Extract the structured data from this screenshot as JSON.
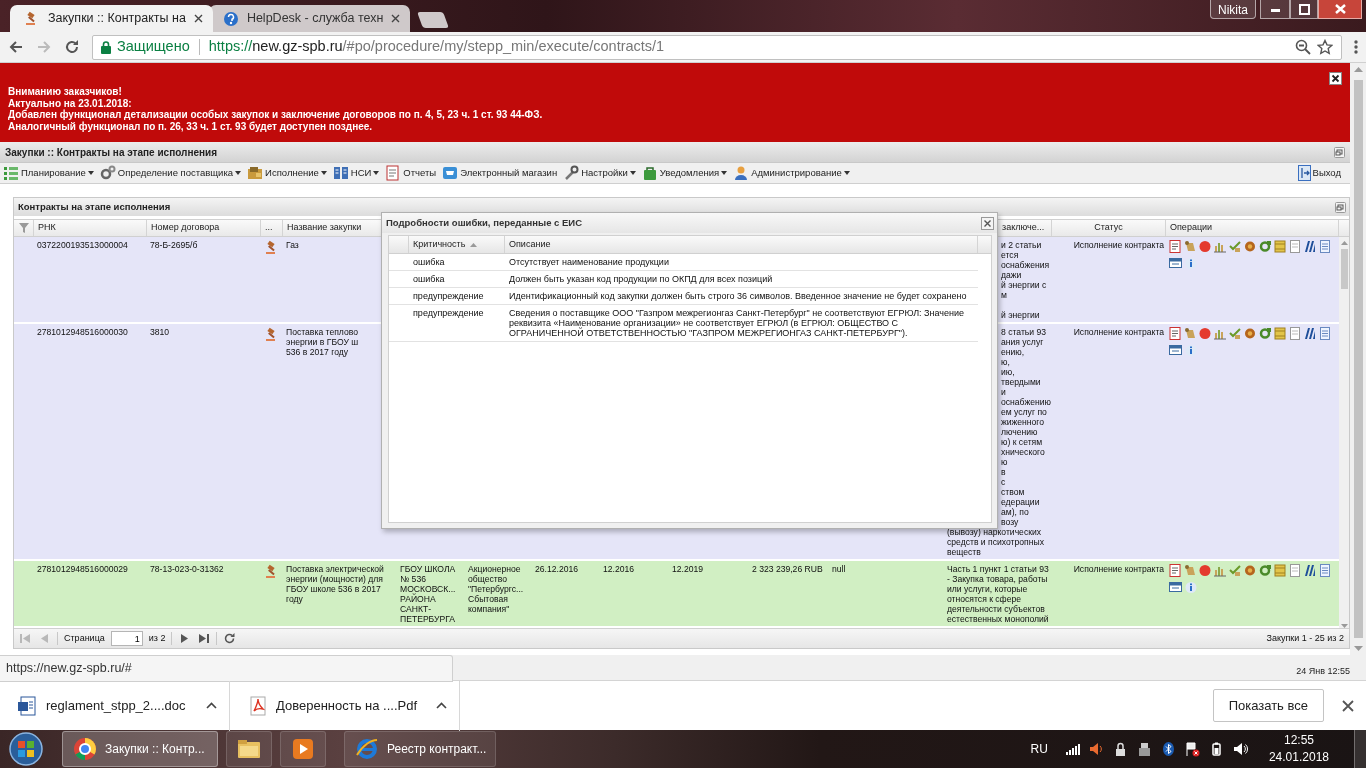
{
  "browser": {
    "tabs": [
      {
        "title": "Закупки :: Контракты на",
        "selected": true,
        "kind": "gavel"
      },
      {
        "title": "HelpDesk - служба техн",
        "selected": false,
        "kind": "help"
      }
    ],
    "profile": "Nikita",
    "security_label": "Защищено",
    "url": {
      "scheme": "https://",
      "host": "new.gz-spb.ru",
      "path": "/#po/procedure/my/stepp_min/execute/contracts/1"
    }
  },
  "banner": {
    "lines": [
      "Вниманию заказчиков!",
      "Актуально на 23.01.2018:",
      "Добавлен функционал детализации особых закупок и заключение договоров по п. 4, 5, 23 ч. 1 ст. 93 44-ФЗ.",
      "Аналогичный функционал по п. 26, 33 ч. 1 ст. 93 будет доступен позднее."
    ]
  },
  "app": {
    "title": "Закупки :: Контракты на этапе исполнения",
    "menu": [
      {
        "label": "Планирование",
        "dropdown": true,
        "kind": "plan"
      },
      {
        "label": "Определение поставщика",
        "dropdown": true,
        "kind": "gears"
      },
      {
        "label": "Исполнение",
        "dropdown": true,
        "kind": "box"
      },
      {
        "label": "НСИ",
        "dropdown": true,
        "kind": "book"
      },
      {
        "label": "Отчеты",
        "dropdown": false,
        "kind": "report"
      },
      {
        "label": "Электронный магазин",
        "dropdown": false,
        "kind": "cart"
      },
      {
        "label": "Настройки",
        "dropdown": true,
        "kind": "wrench"
      },
      {
        "label": "Уведомления",
        "dropdown": true,
        "kind": "bag"
      },
      {
        "label": "Администрирование",
        "dropdown": true,
        "kind": "user"
      }
    ],
    "logout": "Выход"
  },
  "grid": {
    "title": "Контракты на этапе исполнения",
    "columns": [
      {
        "kind": "filter"
      },
      {
        "label": "РНК"
      },
      {
        "label": "Номер договора"
      },
      {
        "label": "..."
      },
      {
        "label": "Название закупки"
      },
      null,
      null,
      null,
      null,
      null,
      null,
      null,
      {
        "label_fragment": "заключе..."
      },
      {
        "label": "Статус"
      },
      {
        "label": "Операции"
      }
    ],
    "rows": [
      {
        "rnk": "0372200193513000004",
        "contract_number": "78-Б-2695/б",
        "name": "Газ",
        "column_13_fragment": "и 2 статьи\nется\nоснабжения\nдажи\nй энергии с\nм\n\nй энергии",
        "status": "Исполнение контракта",
        "color": "#e5e5f8"
      },
      {
        "rnk": "2781012948516000030",
        "contract_number": "3810",
        "name": "Поставка теплово\nэнергии в ГБОУ ш\n536 в 2017 году",
        "column_13_fragment": "8 статьи 93\nания услуг\nению,\nю,\nию,\nтвердыми\nи\nоснабжению\nем услуг по\nжиженного\nлючению\nю) к сетям\nхнического\nю\nв\nс\nством\nедерации\nам), по\nвозу",
        "column_13": "(вывозу) наркотических\nсредств и психотропных\nвеществ",
        "status": "Исполнение контракта",
        "color": "#e5e5f8"
      },
      {
        "rnk": "2781012948516000029",
        "contract_number": "78-13-023-0-31362",
        "name": "Поставка электрической энергии (мощности) для ГБОУ школе 536 в 2017 году",
        "column_6": "ГБОУ ШКОЛА № 536 МОСКОВСК... РАЙОНА САНКТ-ПЕТЕРБУРГА",
        "column_7": "Акционерное общество \"Петербургс... Сбытовая компания\"",
        "column_8": "26.12.2016",
        "column_9": "12.2016",
        "column_10": "12.2019",
        "column_11": "2 323 239,26 RUB",
        "column_12": "null",
        "column_13": "Часть 1 пункт 1 статьи 93 - Закупка товара, работы или услуги, которые относятся к сфере деятельности субъектов естественных монополий",
        "status": "Исполнение контракта",
        "color": "#d1efc3"
      }
    ],
    "pager": {
      "first_controls": [
        {
          "kind": "first",
          "disabled": true
        },
        {
          "kind": "prev",
          "disabled": true
        }
      ],
      "page_label": "Страница",
      "page": "1",
      "page_count": "из 2",
      "last_controls": [
        {
          "kind": "next",
          "disabled": false
        },
        {
          "kind": "last",
          "disabled": false
        },
        {
          "kind": "refresh",
          "disabled": false
        }
      ],
      "summary": "Закупки 1 - 25 из 2"
    }
  },
  "dialog": {
    "title": "Подробности ошибки, переданные с ЕИС",
    "columns": [
      {
        "label": "Критичность",
        "sorted": true
      },
      {
        "label": "Описание",
        "sorted": false
      }
    ],
    "rows": [
      {
        "severity": "ошибка",
        "description": "Отсутствует наименование продукции"
      },
      {
        "severity": "ошибка",
        "description": "Должен быть указан код продукции по ОКПД для всех позиций"
      },
      {
        "severity": "предупреждение",
        "description": "Идентификационный код закупки должен быть строго 36 символов. Введенное значение не будет сохранено"
      },
      {
        "severity": "предупреждение",
        "description": "Сведения о поставщике ООО \"Газпром межрегионгаз Санкт-Петербург\" не соответствуют ЕГРЮЛ: Значение реквизита «Наименование организации» не соответствует ЕГРЮЛ (в ЕГРЮЛ: ОБЩЕСТВО С ОГРАНИЧЕННОЙ ОТВЕТСТВЕННОСТЬЮ \"ГАЗПРОМ МЕЖРЕГИОНГАЗ САНКТ-ПЕТЕРБУРГ\")."
      }
    ]
  },
  "status_url": "https://new.gz-spb.ru/#",
  "footer_time": "24 Янв 12:55",
  "downloads": {
    "items": [
      {
        "name": "reglament_stpp_2....doc",
        "kind": "doc"
      },
      {
        "name": "Доверенность на ....Pdf",
        "kind": "pdf"
      }
    ],
    "show_all": "Показать все"
  },
  "taskbar": {
    "items": [
      {
        "kind": "chrome",
        "label": "Закупки :: Контр...",
        "selected": true
      },
      {
        "kind": "folder",
        "selected": false
      },
      {
        "kind": "media",
        "selected": false
      },
      {
        "kind": "ie",
        "label": "Реестр контракт...",
        "selected": false
      }
    ],
    "language": "RU",
    "time": "12:55",
    "date": "24.01.2018"
  }
}
